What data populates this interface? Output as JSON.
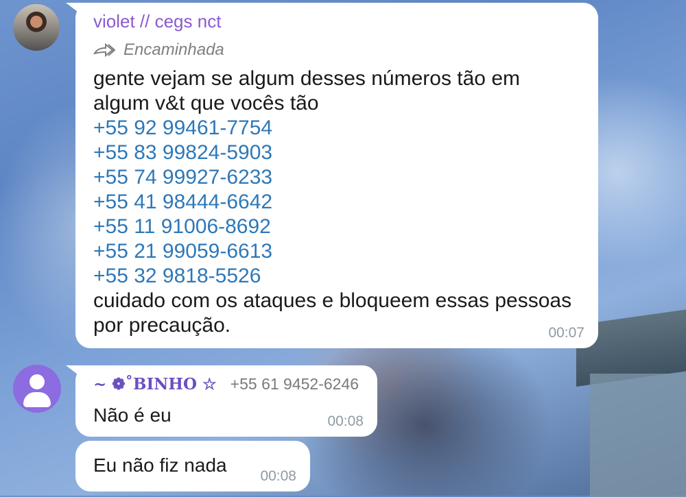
{
  "message1": {
    "sender": "violet // cegs nct",
    "forwarded_label": "Encaminhada",
    "intro": "gente vejam se algum desses números tão em algum v&t que vocês tão",
    "phones": [
      "+55 92 99461-7754",
      "+55 83 99824-5903",
      "+55 74 99927-6233",
      "+55 41 98444-6642",
      "+55 11 91006-8692",
      "+55 21 99059-6613",
      "+55 32 9818-5526"
    ],
    "outro": "cuidado com os ataques e bloqueem essas pessoas por precaução.",
    "time": "00:07"
  },
  "message2": {
    "sender": "~ ❁˚BINHO ☆",
    "sender_phone": "+55 61 9452-6246",
    "text": "Não é eu",
    "time": "00:08"
  },
  "message3": {
    "text": "Eu não fiz nada",
    "time": "00:08"
  },
  "icons": {
    "forward": "forward-arrow-icon",
    "default_avatar": "user-placeholder-icon"
  },
  "colors": {
    "sender_purple": "#8a5ad0",
    "link_blue": "#2d78b8",
    "avatar_purple": "#8c6ce0"
  }
}
